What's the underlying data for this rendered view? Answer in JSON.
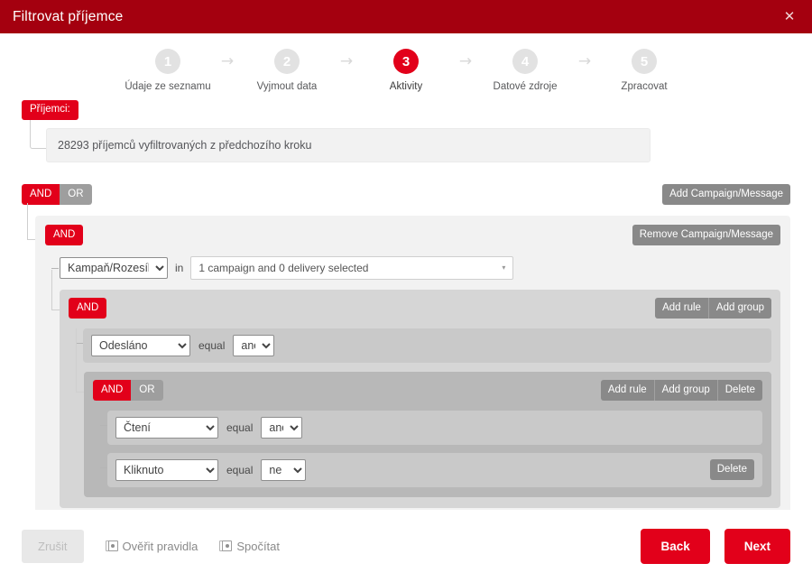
{
  "window": {
    "title": "Filtrovat příjemce",
    "close_icon": "close-icon",
    "close_glyph": "✕",
    "header_bg": "#a4000f"
  },
  "stepper": {
    "arrow_glyph": "→",
    "active_index": 3,
    "steps": [
      {
        "number": "1",
        "label": "Údaje ze seznamu"
      },
      {
        "number": "2",
        "label": "Vyjmout data"
      },
      {
        "number": "3",
        "label": "Aktivity"
      },
      {
        "number": "4",
        "label": "Datové zdroje"
      },
      {
        "number": "5",
        "label": "Zpracovat"
      }
    ]
  },
  "recipients": {
    "badge_label": "Příjemci:",
    "info_text": "28293 příjemců vyfiltrovaných z předchozího kroku"
  },
  "query_builder": {
    "root": {
      "and_label": "AND",
      "or_label": "OR",
      "add_campaign_label": "Add Campaign/Message"
    },
    "campaign_group": {
      "and_label": "AND",
      "remove_campaign_label": "Remove Campaign/Message",
      "field_value": "Kampaň/Rozesílka",
      "field_options": [
        "Kampaň/Rozesílka"
      ],
      "in_label": "in",
      "picker_value": "1 campaign and 0 delivery selected",
      "picker_caret": "▾"
    },
    "inner_group": {
      "and_label": "AND",
      "add_rule_label": "Add rule",
      "add_group_label": "Add group",
      "rules": [
        {
          "field_value": "Odesláno",
          "field_options": [
            "Odesláno"
          ],
          "operator": "equal",
          "value_value": "ano",
          "value_options": [
            "ano",
            "ne"
          ],
          "has_delete": false,
          "delete_label": "Delete"
        }
      ]
    },
    "deepest_group": {
      "and_label": "AND",
      "or_label": "OR",
      "add_rule_label": "Add rule",
      "add_group_label": "Add group",
      "delete_label": "Delete",
      "rules": [
        {
          "field_value": "Čtení",
          "field_options": [
            "Čtení"
          ],
          "operator": "equal",
          "value_value": "ano",
          "value_options": [
            "ano",
            "ne"
          ],
          "has_delete": false,
          "delete_label": "Delete"
        },
        {
          "field_value": "Kliknuto",
          "field_options": [
            "Kliknuto"
          ],
          "operator": "equal",
          "value_value": "ne",
          "value_options": [
            "ano",
            "ne"
          ],
          "has_delete": true,
          "delete_label": "Delete"
        }
      ]
    }
  },
  "footer": {
    "cancel_label": "Zrušit",
    "validate_label": "Ověřit pravidla",
    "count_label": "Spočítat",
    "back_label": "Back",
    "next_label": "Next"
  },
  "colors": {
    "header_red": "#a4000f",
    "accent_red": "#e2001a",
    "gray_button": "#898989",
    "or_gray": "#9e9e9e"
  }
}
